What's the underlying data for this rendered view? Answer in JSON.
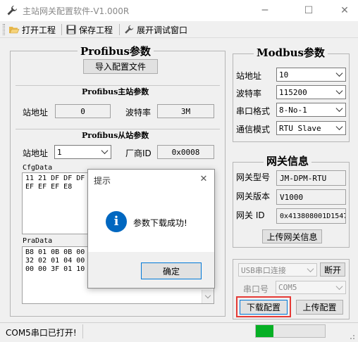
{
  "window": {
    "title": "主站网关配置软件-V1.000R",
    "minimize_glyph": "─",
    "maximize_glyph": "☐",
    "close_glyph": "✕"
  },
  "toolbar": {
    "open_project": "打开工程",
    "save_project": "保存工程",
    "debug_window": "展开调试窗口"
  },
  "profibus": {
    "title": "Profibus参数",
    "import_button": "导入配置文件",
    "master": {
      "title": "Profibus主站参数",
      "station_label": "站地址",
      "station_value": "0",
      "baud_label": "波特率",
      "baud_value": "3M"
    },
    "slave": {
      "title": "Profibus从站参数",
      "station_label": "站地址",
      "station_value": "1",
      "vendor_label": "厂商ID",
      "vendor_value": "0x0008",
      "cfg_label": "CfgData",
      "cfg_text": "11 21 DF DF DF\nEF EF EF E8",
      "pra_label": "PraData",
      "pra_text": "B8 01 0B 0B 00\n32 02 01 04 00\n00 00 3F 01 10"
    }
  },
  "modbus": {
    "title": "Modbus参数",
    "station_label": "站地址",
    "station_value": "10",
    "baud_label": "波特率",
    "baud_value": "115200",
    "format_label": "串口格式",
    "format_value": "8-No-1",
    "mode_label": "通信模式",
    "mode_value": "RTU Slave"
  },
  "gateway": {
    "title": "网关信息",
    "model_label": "网关型号",
    "model_value": "JM-DPM-RTU",
    "version_label": "网关版本",
    "version_value": "V1000",
    "id_label": "网关 ID",
    "id_value": "0x413808001D1547",
    "upload_button": "上传网关信息"
  },
  "connection": {
    "usb_value": "USB串口连接",
    "disconnect_button": "断开",
    "port_label": "串口号",
    "port_value": "COM5",
    "download_button": "下载配置",
    "upload_button": "上传配置"
  },
  "dialog": {
    "title": "提示",
    "message": "参数下载成功!",
    "ok_button": "确定",
    "info_glyph": "i",
    "close_glyph": "✕"
  },
  "status": {
    "text": "COM5串口已打开!",
    "progress": 0.25
  },
  "colors": {
    "highlight": "#e53935",
    "progress": "#06b025",
    "info_icon": "#0067c0"
  }
}
